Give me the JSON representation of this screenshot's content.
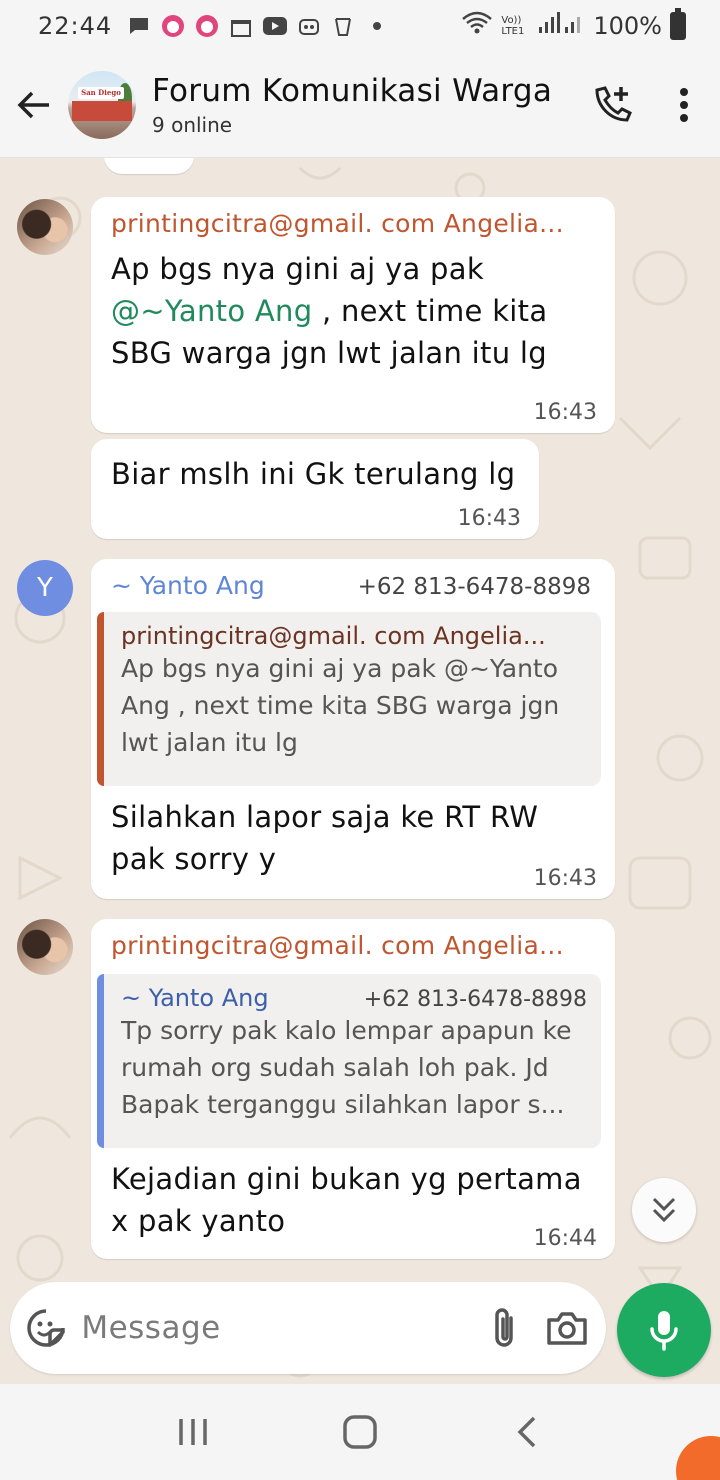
{
  "status_bar": {
    "time": "22:44",
    "network": "Vo)) LTE1",
    "battery_percent": "100%"
  },
  "header": {
    "title": "Forum Komunikasi Warga",
    "subtitle": "9 online",
    "avatar_sign_text": "San Diego"
  },
  "messages": [
    {
      "sender": "printingcitra@gmail. com Angelia...",
      "line1": "Ap bgs nya gini aj ya pak",
      "mention": "@~Yanto Ang",
      "line2_rest": " , next time kita",
      "line3": "SBG warga jgn lwt jalan itu lg",
      "time": "16:43"
    },
    {
      "text": "Biar mslh ini Gk terulang lg",
      "time": "16:43"
    },
    {
      "avatar_letter": "Y",
      "sender": "~ Yanto Ang",
      "phone": "+62 813-6478-8898",
      "quote_sender": "printingcitra@gmail. com Angelia...",
      "quote_text": "Ap bgs nya gini aj ya pak @~Yanto Ang , next time kita SBG warga jgn lwt jalan itu lg",
      "text": "Silahkan lapor saja ke RT RW pak sorry y",
      "time": "16:43"
    },
    {
      "sender": "printingcitra@gmail. com Angelia...",
      "quote_sender": "~ Yanto Ang",
      "quote_phone": "+62 813-6478-8898",
      "quote_text": "Tp sorry pak kalo lempar apapun ke rumah org sudah salah loh pak. Jd Bapak terganggu silahkan lapor s...",
      "text": "Kejadian gini bukan yg pertama x pak yanto",
      "time": "16:44"
    }
  ],
  "input": {
    "placeholder": "Message"
  },
  "colors": {
    "accent_green": "#1daa61",
    "sender_orange": "#c0562f",
    "sender_blue": "#5f86d6",
    "mention_green": "#1f8a5b",
    "wallpaper": "#efe7dd"
  },
  "icons": [
    "arrow-left-icon",
    "add-call-icon",
    "more-vert-icon",
    "sticker-icon",
    "paperclip-icon",
    "camera-icon",
    "mic-icon",
    "chevron-double-down-icon"
  ]
}
